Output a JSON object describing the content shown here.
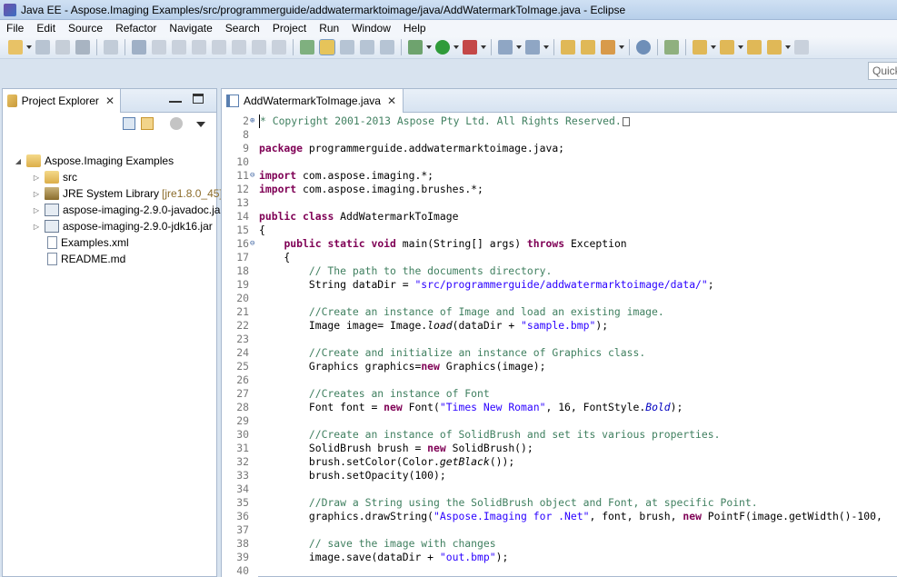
{
  "window": {
    "title": "Java EE - Aspose.Imaging Examples/src/programmerguide/addwatermarktoimage/java/AddWatermarkToImage.java - Eclipse"
  },
  "menu": [
    "File",
    "Edit",
    "Source",
    "Refactor",
    "Navigate",
    "Search",
    "Project",
    "Run",
    "Window",
    "Help"
  ],
  "quick_access": {
    "placeholder": "Quick"
  },
  "explorer": {
    "tab_label": "Project Explorer",
    "close_glyph": "✕",
    "tree": [
      {
        "label": "Aspose.Imaging Examples",
        "suffix": "",
        "icon": "project-folder-icon",
        "depth": 0,
        "twisty": "◢"
      },
      {
        "label": "src",
        "suffix": "",
        "icon": "source-folder-icon",
        "depth": 1,
        "twisty": "▷"
      },
      {
        "label": "JRE System Library",
        "suffix": "[jre1.8.0_45]",
        "icon": "library-icon",
        "depth": 1,
        "twisty": "▷"
      },
      {
        "label": "aspose-imaging-2.9.0-javadoc.ja",
        "suffix": "",
        "icon": "jar-icon",
        "depth": 1,
        "twisty": "▷"
      },
      {
        "label": "aspose-imaging-2.9.0-jdk16.jar",
        "suffix": "",
        "icon": "jar-icon",
        "depth": 1,
        "twisty": "▷"
      },
      {
        "label": "Examples.xml",
        "suffix": "",
        "icon": "xml-file-icon",
        "depth": 1,
        "twisty": ""
      },
      {
        "label": "README.md",
        "suffix": "",
        "icon": "text-file-icon",
        "depth": 1,
        "twisty": ""
      }
    ]
  },
  "editor": {
    "tab_label": "AddWatermarkToImage.java",
    "close_glyph": "✕",
    "lines": [
      {
        "n": "2",
        "fold": "⊕",
        "segs": [
          [
            "cm",
            "* Copyright 2001-2013 Aspose Pty Ltd. All Rights Reserved."
          ]
        ],
        "box": true
      },
      {
        "n": "8",
        "segs": []
      },
      {
        "n": "9",
        "segs": [
          [
            "kw",
            "package"
          ],
          [
            "",
            "programmerguide.addwatermarktoimage.java;"
          ]
        ]
      },
      {
        "n": "10",
        "segs": []
      },
      {
        "n": "11",
        "fold": "⊖",
        "segs": [
          [
            "kw",
            "import"
          ],
          [
            "",
            "com.aspose.imaging.*;"
          ]
        ]
      },
      {
        "n": "12",
        "segs": [
          [
            "kw",
            "import"
          ],
          [
            "",
            "com.aspose.imaging.brushes.*;"
          ]
        ]
      },
      {
        "n": "13",
        "segs": []
      },
      {
        "n": "14",
        "segs": [
          [
            "kw",
            "public"
          ],
          [
            "",
            ""
          ],
          [
            "kw",
            "class"
          ],
          [
            "",
            "AddWatermarkToImage"
          ]
        ]
      },
      {
        "n": "15",
        "segs": [
          [
            "",
            "{"
          ]
        ]
      },
      {
        "n": "16",
        "fold": "⊖",
        "segs": [
          [
            "",
            "    "
          ],
          [
            "kw",
            "public"
          ],
          [
            "",
            ""
          ],
          [
            "kw",
            "static"
          ],
          [
            "",
            ""
          ],
          [
            "kw",
            "void"
          ],
          [
            "",
            "main(String[] args) "
          ],
          [
            "kw",
            "throws"
          ],
          [
            "",
            "Exception"
          ]
        ]
      },
      {
        "n": "17",
        "segs": [
          [
            "",
            "    {"
          ]
        ]
      },
      {
        "n": "18",
        "segs": [
          [
            "cm",
            "        // The path to the documents directory."
          ]
        ]
      },
      {
        "n": "19",
        "segs": [
          [
            "",
            "        String dataDir = "
          ],
          [
            "st",
            "\"src/programmerguide/addwatermarktoimage/data/\""
          ],
          [
            "",
            ";"
          ]
        ]
      },
      {
        "n": "20",
        "segs": []
      },
      {
        "n": "21",
        "segs": [
          [
            "cm",
            "        //Create an instance of Image and load an existing image."
          ]
        ]
      },
      {
        "n": "22",
        "segs": [
          [
            "",
            "        Image image= Image."
          ],
          [
            "it",
            "load"
          ],
          [
            "",
            "(dataDir + "
          ],
          [
            "st",
            "\"sample.bmp\""
          ],
          [
            "",
            ");"
          ]
        ]
      },
      {
        "n": "23",
        "segs": []
      },
      {
        "n": "24",
        "segs": [
          [
            "cm",
            "        //Create and initialize an instance of Graphics class."
          ]
        ]
      },
      {
        "n": "25",
        "segs": [
          [
            "",
            "        Graphics graphics="
          ],
          [
            "kw",
            "new"
          ],
          [
            "",
            "Graphics(image);"
          ]
        ]
      },
      {
        "n": "26",
        "segs": []
      },
      {
        "n": "27",
        "segs": [
          [
            "cm",
            "        //Creates an instance of Font"
          ]
        ]
      },
      {
        "n": "28",
        "segs": [
          [
            "",
            "        Font font = "
          ],
          [
            "kw",
            "new"
          ],
          [
            "",
            "Font("
          ],
          [
            "st",
            "\"Times New Roman\""
          ],
          [
            "",
            ", 16, FontStyle."
          ],
          [
            "it fld",
            "Bold"
          ],
          [
            "",
            ");"
          ]
        ]
      },
      {
        "n": "29",
        "segs": []
      },
      {
        "n": "30",
        "segs": [
          [
            "cm",
            "        //Create an instance of SolidBrush and set its various properties."
          ]
        ]
      },
      {
        "n": "31",
        "segs": [
          [
            "",
            "        SolidBrush brush = "
          ],
          [
            "kw",
            "new"
          ],
          [
            "",
            "SolidBrush();"
          ]
        ]
      },
      {
        "n": "32",
        "segs": [
          [
            "",
            "        brush.setColor(Color."
          ],
          [
            "it",
            "getBlack"
          ],
          [
            "",
            "());"
          ]
        ]
      },
      {
        "n": "33",
        "segs": [
          [
            "",
            "        brush.setOpacity(100);"
          ]
        ]
      },
      {
        "n": "34",
        "segs": []
      },
      {
        "n": "35",
        "segs": [
          [
            "cm",
            "        //Draw a String using the SolidBrush object and Font, at specific Point."
          ]
        ]
      },
      {
        "n": "36",
        "segs": [
          [
            "",
            "        graphics.drawString("
          ],
          [
            "st",
            "\"Aspose.Imaging for .Net\""
          ],
          [
            "",
            ", font, brush, "
          ],
          [
            "kw",
            "new"
          ],
          [
            "",
            "PointF(image.getWidth()-100,"
          ]
        ]
      },
      {
        "n": "37",
        "segs": []
      },
      {
        "n": "38",
        "segs": [
          [
            "cm",
            "        // save the image with changes"
          ]
        ]
      },
      {
        "n": "39",
        "segs": [
          [
            "",
            "        image.save(dataDir + "
          ],
          [
            "st",
            "\"out.bmp\""
          ],
          [
            "",
            ");"
          ]
        ]
      },
      {
        "n": "40",
        "segs": []
      }
    ]
  }
}
